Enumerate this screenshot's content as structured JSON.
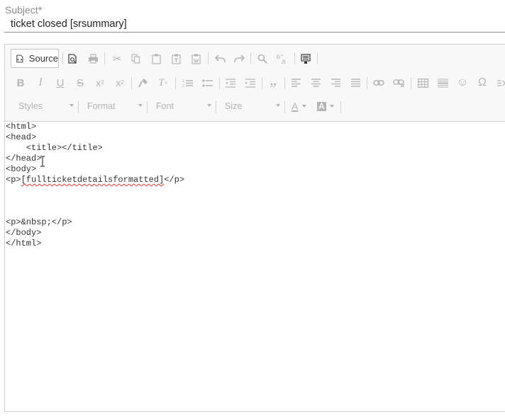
{
  "subject": {
    "label": "Subject*",
    "value": " ticket closed [srsummary]"
  },
  "toolbar": {
    "source_label": "Source",
    "styles_label": "Styles",
    "format_label": "Format",
    "font_label": "Font",
    "size_label": "Size"
  },
  "code": {
    "lines": [
      "<html>",
      "<head>",
      "    <title></title>",
      "</head>",
      "<body>",
      "<p>",
      "",
      "",
      "<p>&nbsp;</p>",
      "</body>",
      "</html>"
    ],
    "placeholder_token": "[fullticketdetailsformatted]",
    "p_close": "</p>"
  },
  "colors": {
    "spell_underline": "#e03a3a",
    "toolbar_bg": "#f8f8f8",
    "border": "#d1d1d1"
  }
}
